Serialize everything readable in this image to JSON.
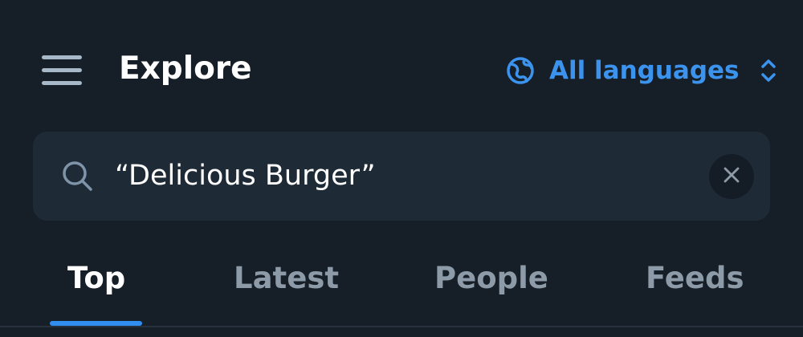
{
  "header": {
    "title": "Explore",
    "menu_icon": "hamburger-menu-icon",
    "language": {
      "label": "All languages",
      "icon": "globe-icon",
      "chevron_icon": "chevron-up-down-icon"
    }
  },
  "search": {
    "value": "“Delicious Burger”",
    "icon": "search-icon",
    "clear_icon": "close-icon"
  },
  "tabs": [
    {
      "label": "Top",
      "active": true
    },
    {
      "label": "Latest",
      "active": false
    },
    {
      "label": "People",
      "active": false
    },
    {
      "label": "Feeds",
      "active": false
    }
  ],
  "colors": {
    "background": "#161e27",
    "search_background": "#1f2a37",
    "accent": "#3b93ee",
    "text_primary": "#ffffff",
    "text_muted": "#8d9aa8"
  }
}
